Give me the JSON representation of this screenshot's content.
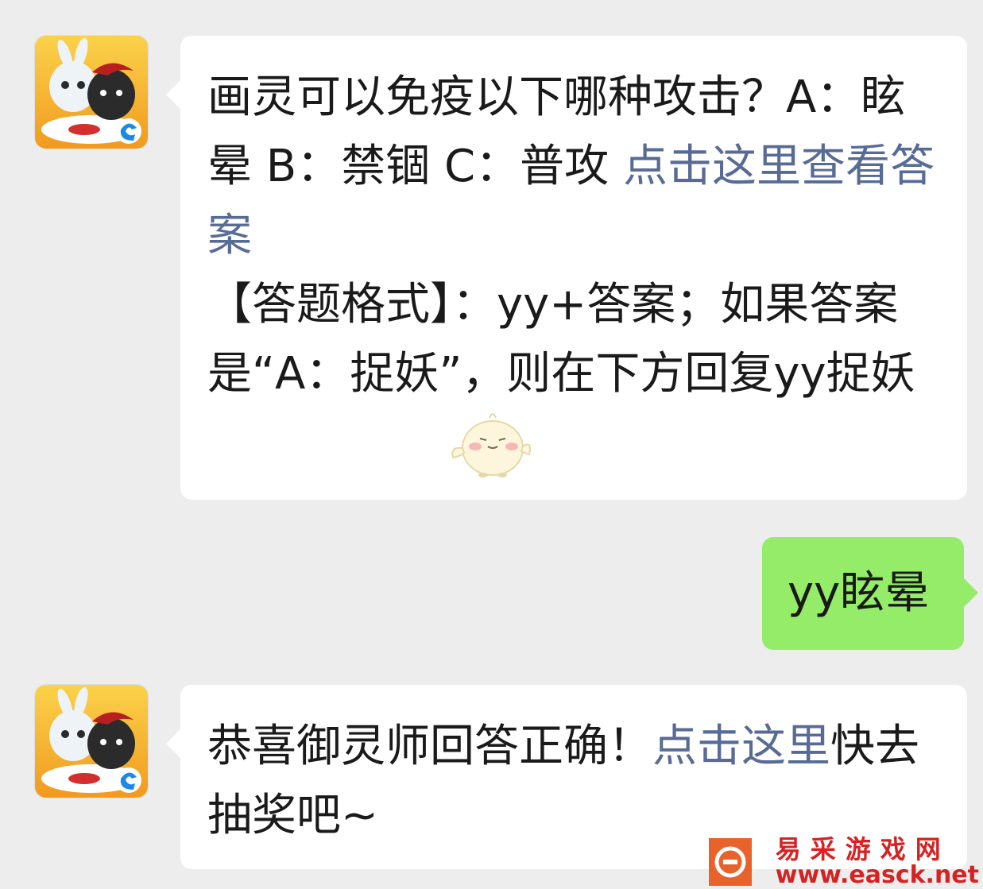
{
  "colors": {
    "background": "#ededed",
    "bubble_in": "#ffffff",
    "bubble_out": "#95ec69",
    "link": "#576b95",
    "watermark": "#d62222"
  },
  "messages": [
    {
      "sender": "official",
      "avatar_icon": "game-app-avatar-icon",
      "question": "画灵可以免疫以下哪种攻击？A：眩晕 B：禁锢 C：普攻",
      "link": "点击这里查看答案",
      "format_text": "【答题格式】：yy+答案；如果答案是“A：捉妖”，则在下方回复yy捉妖",
      "sticker_icon": "chick-sticker-icon"
    },
    {
      "sender": "me",
      "text": "yy眩晕"
    },
    {
      "sender": "official",
      "avatar_icon": "game-app-avatar-icon",
      "text_before": "恭喜御灵师回答正确！",
      "link": "点击这里",
      "text_after": "快去抽奖吧~"
    }
  ],
  "watermark": {
    "logo_icon": "easck-logo-icon",
    "cn": "易采游戏网",
    "en": "www.easck.net"
  }
}
